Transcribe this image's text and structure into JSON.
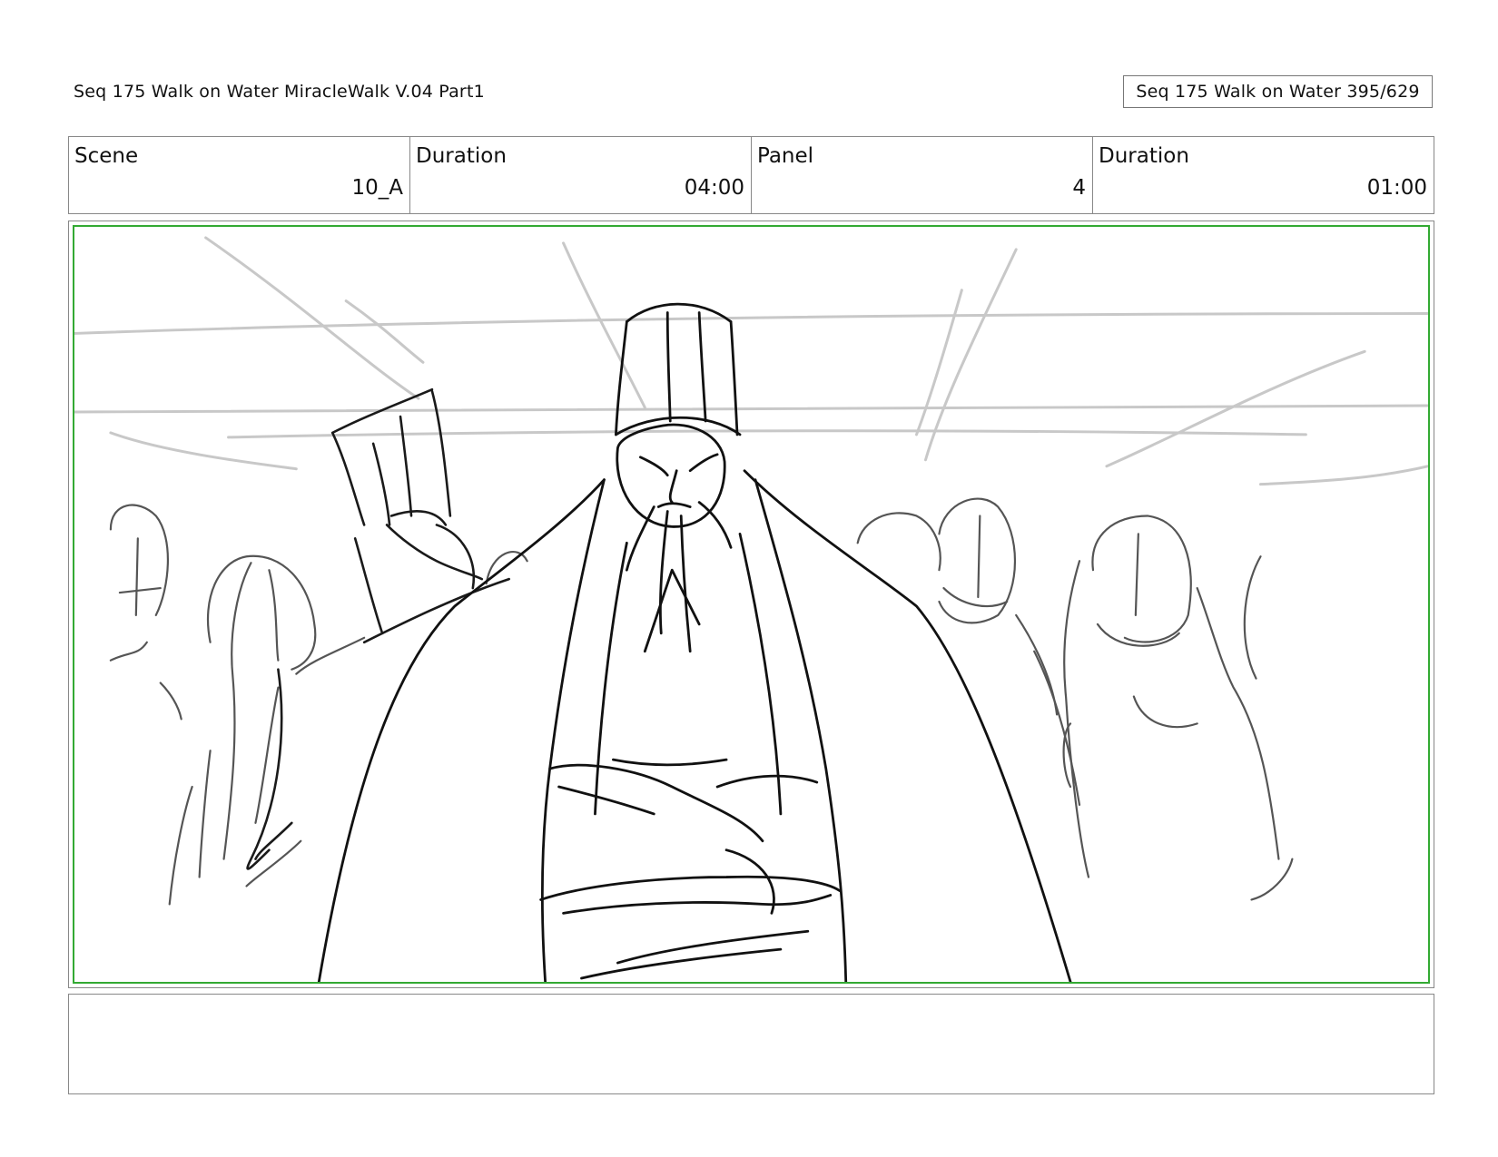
{
  "header": {
    "title": "Seq 175 Walk on Water  MiracleWalk V.04 Part1",
    "page_indicator": "Seq 175 Walk on Water 395/629"
  },
  "info": {
    "scene_label": "Scene",
    "scene_value": "10_A",
    "duration_label": "Duration",
    "duration_value": "04:00",
    "panel_label": "Panel",
    "panel_value": "4",
    "panel_duration_label": "Duration",
    "panel_duration_value": "01:00"
  },
  "panel": {
    "frame_color": "#33aa33",
    "sketch_color": "#111111",
    "background_sketch_color": "#c8c8c8"
  },
  "notes": {
    "text": ""
  }
}
